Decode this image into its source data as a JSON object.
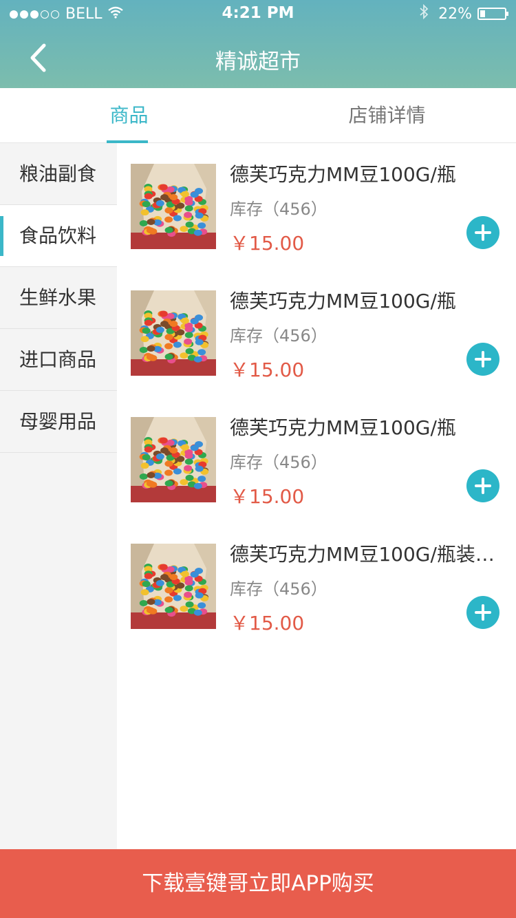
{
  "status_bar": {
    "carrier": "BELL",
    "time": "4:21 PM",
    "battery_percent": "22%",
    "battery_level": 0.22,
    "signal_dots_filled": 3,
    "signal_dots_total": 5,
    "icons": [
      "wifi-icon",
      "bluetooth-icon",
      "battery-icon"
    ]
  },
  "nav": {
    "title": "精诚超市",
    "back_icon": "chevron-left-icon"
  },
  "tabs": [
    {
      "label": "商品",
      "active": true
    },
    {
      "label": "店铺详情",
      "active": false
    }
  ],
  "sidebar": {
    "items": [
      {
        "label": "粮油副食",
        "active": false
      },
      {
        "label": "食品饮料",
        "active": true
      },
      {
        "label": "生鲜水果",
        "active": false
      },
      {
        "label": "进口商品",
        "active": false
      },
      {
        "label": "母婴用品",
        "active": false
      }
    ]
  },
  "products": [
    {
      "name": "德芙巧克力MM豆100G/瓶",
      "stock": "库存（456）",
      "price": "￥15.00"
    },
    {
      "name": "德芙巧克力MM豆100G/瓶",
      "stock": "库存（456）",
      "price": "￥15.00"
    },
    {
      "name": "德芙巧克力MM豆100G/瓶",
      "stock": "库存（456）",
      "price": "￥15.00"
    },
    {
      "name": "德芙巧克力MM豆100G/瓶装…",
      "stock": "库存（456）",
      "price": "￥15.00"
    }
  ],
  "footer": {
    "label": "下载壹键哥立即APP购买"
  },
  "colors": {
    "accent": "#3bb7c8",
    "price": "#e25a47",
    "footer": "#e85d4d",
    "header_top": "#63b2be",
    "header_bottom": "#7cbdad"
  }
}
